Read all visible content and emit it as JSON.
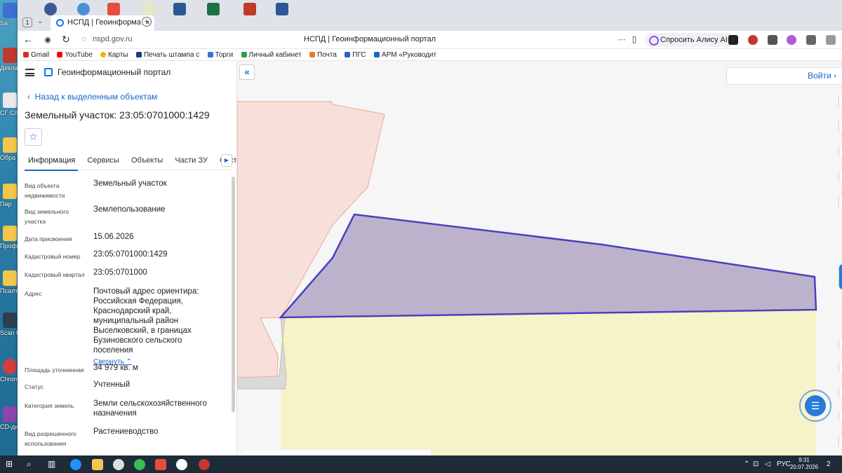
{
  "desktop": {
    "icons": [
      "Sa",
      "Декла",
      "СГ Справ",
      "Обра заявл",
      "Пар",
      "Профи",
      "Псалт",
      "Scan to",
      "Chrom",
      "CD-дис - Ярл"
    ]
  },
  "browser": {
    "tab_count": "1",
    "tab_title": "НСПД | Геоинформац",
    "url": "nspd.gov.ru",
    "page_title": "НСПД | Геоинформационный портал",
    "ask_alice": "Спросить Алису AI",
    "bookmarks": [
      "Gmail",
      "YouTube",
      "Карты",
      "Печать штампа с",
      "Торги",
      "Личный кабинет",
      "Почта",
      "ПГС",
      "АРМ «Руководит"
    ]
  },
  "panel": {
    "portal_title": "Геоинформационный портал",
    "back_link": "Назад к выделенным объектам",
    "heading": "Земельный участок: 23:05:0701000:1429",
    "tabs": [
      "Информация",
      "Сервисы",
      "Объекты",
      "Части ЗУ",
      "Состав"
    ],
    "collapse_label": "Свернуть",
    "properties": [
      {
        "label": "Вид объекта недвижимости",
        "value": "Земельный участок"
      },
      {
        "label": "Вид земельного участка",
        "value": "Землепользование"
      },
      {
        "label": "Дата присвоения",
        "value": "15.06.2026"
      },
      {
        "label": "Кадастровый номер",
        "value": "23:05:0701000:1429"
      },
      {
        "label": "Кадастровый квартал",
        "value": "23:05:0701000"
      },
      {
        "label": "Адрес",
        "value": "Почтовый адрес ориентира: Российская Федерация, Краснодарский край, муниципальный район Выселковский, в границах Бузиновского сельского поселения"
      },
      {
        "label": "Площадь уточненная",
        "value": "34 979 кв. м"
      },
      {
        "label": "Статус",
        "value": "Учтенный"
      },
      {
        "label": "Категория земель",
        "value": "Земли сельскохозяйственного назначения"
      },
      {
        "label": "Вид разрешенного использования",
        "value": "Растениеводство"
      }
    ]
  },
  "map": {
    "login_label": "Войти",
    "colors": {
      "selected_fill": "#bcb2cc",
      "selected_stroke": "#4b3fbf",
      "neighbor_fill": "#f7e0da",
      "neighbor_stroke": "#e8a896",
      "field_fill": "#f7f3c8",
      "grey_fill": "#d9d9d9"
    }
  },
  "taskbar": {
    "language": "РУС",
    "time": "9:31",
    "date": "20.07.2026",
    "notifications": "2"
  }
}
